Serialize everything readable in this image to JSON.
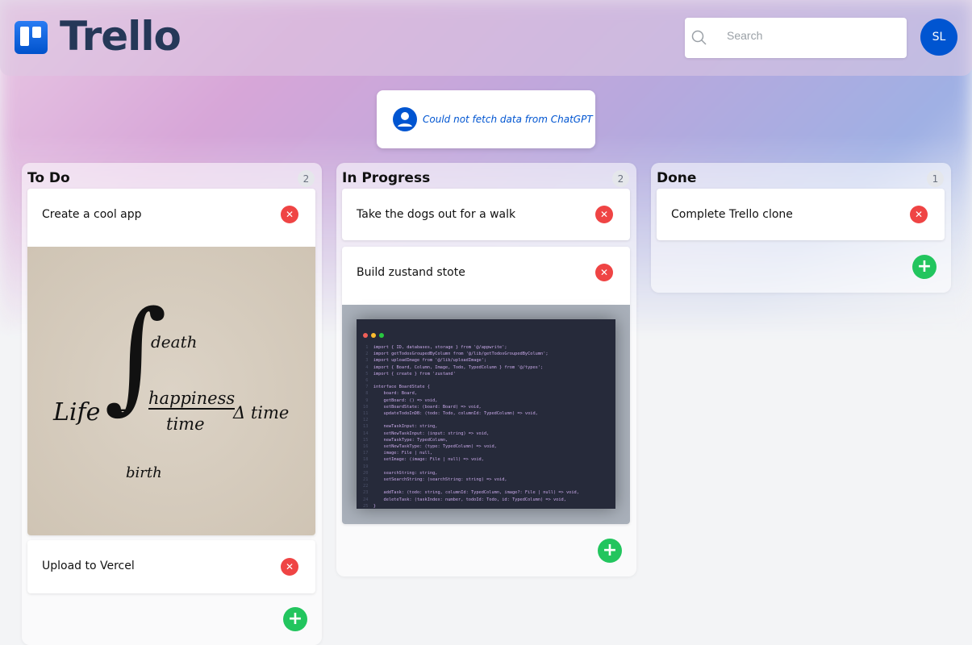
{
  "header": {
    "brand": "Trello",
    "search_placeholder": "Search",
    "avatar_initials": "SL"
  },
  "notice": {
    "text": "Could not fetch data from ChatGPT"
  },
  "colors": {
    "accent": "#0055d1",
    "delete": "#ef4444",
    "add": "#22c55e"
  },
  "columns": [
    {
      "title": "To Do",
      "count": "2",
      "cards": [
        {
          "title": "Create a cool app",
          "image_text": {
            "left": "Life =",
            "top": "death",
            "numerator": "happiness",
            "denominator": "time",
            "right": "Δ time",
            "bottom": "birth"
          }
        },
        {
          "title": "Upload to Vercel"
        }
      ]
    },
    {
      "title": "In Progress",
      "count": "2",
      "cards": [
        {
          "title": "Take the dogs out for a walk"
        },
        {
          "title": "Build zustand stote",
          "image_code": [
            "import { ID, databases, storage } from '@/appwrite';",
            "import getTodosGroupedByColumn from '@/lib/getTodosGroupedByColumn';",
            "import uploadImage from '@/lib/uploadImage';",
            "import { Board, Column, Image, Todo, TypedColumn } from '@/types';",
            "import { create } from 'zustand'",
            "",
            "interface BoardState {",
            "    board: Board,",
            "    getBoard: () => void,",
            "    setBoardState: (board: Board) => void,",
            "    updateTodoInDB: (todo: Todo, columnId: TypedColumn) => void,",
            "",
            "    newTaskInput: string,",
            "    setNewTaskInput: (input: string) => void,",
            "    newTaskType: TypedColumn,",
            "    setNewTaskType: (type: TypedColumn) => void,",
            "    image: File | null,",
            "    setImage: (image: File | null) => void,",
            "",
            "    searchString: string,",
            "    setSearchString: (searchString: string) => void,",
            "",
            "    addTask: (todo: string, columnId: TypedColumn, image?: File | null) => void,",
            "    deleteTask: (taskIndex: number, todoId: Todo, id: TypedColumn) => void,",
            "}"
          ]
        }
      ]
    },
    {
      "title": "Done",
      "count": "1",
      "cards": [
        {
          "title": "Complete Trello clone"
        }
      ]
    }
  ]
}
